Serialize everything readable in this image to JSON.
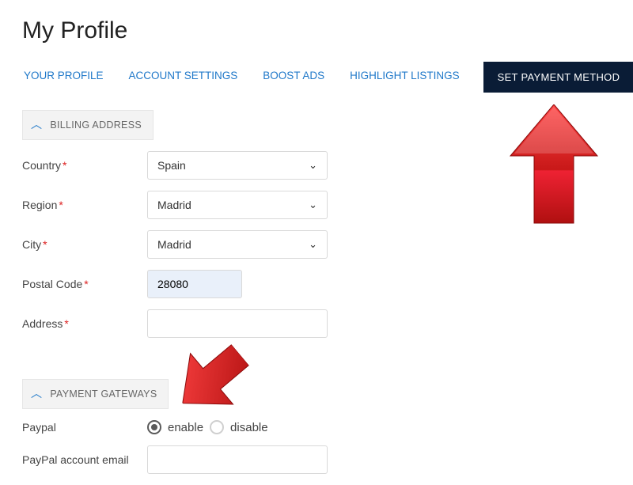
{
  "page": {
    "title": "My Profile"
  },
  "tabs": {
    "profile": "YOUR PROFILE",
    "account": "ACCOUNT SETTINGS",
    "boost": "BOOST ADS",
    "highlight": "HIGHLIGHT LISTINGS",
    "payment": "SET PAYMENT METHOD"
  },
  "sections": {
    "billing": "BILLING ADDRESS",
    "gateways": "PAYMENT GATEWAYS"
  },
  "billing": {
    "country_label": "Country",
    "country_value": "Spain",
    "region_label": "Region",
    "region_value": "Madrid",
    "city_label": "City",
    "city_value": "Madrid",
    "postal_label": "Postal Code",
    "postal_value": "28080",
    "address_label": "Address",
    "address_value": ""
  },
  "gateways": {
    "paypal_label": "Paypal",
    "enable": "enable",
    "disable": "disable",
    "paypal_email_label": "PayPal account email",
    "paypal_email_value": ""
  },
  "symbols": {
    "required": "*",
    "caret": "⌄",
    "chevron_up": "︿"
  }
}
